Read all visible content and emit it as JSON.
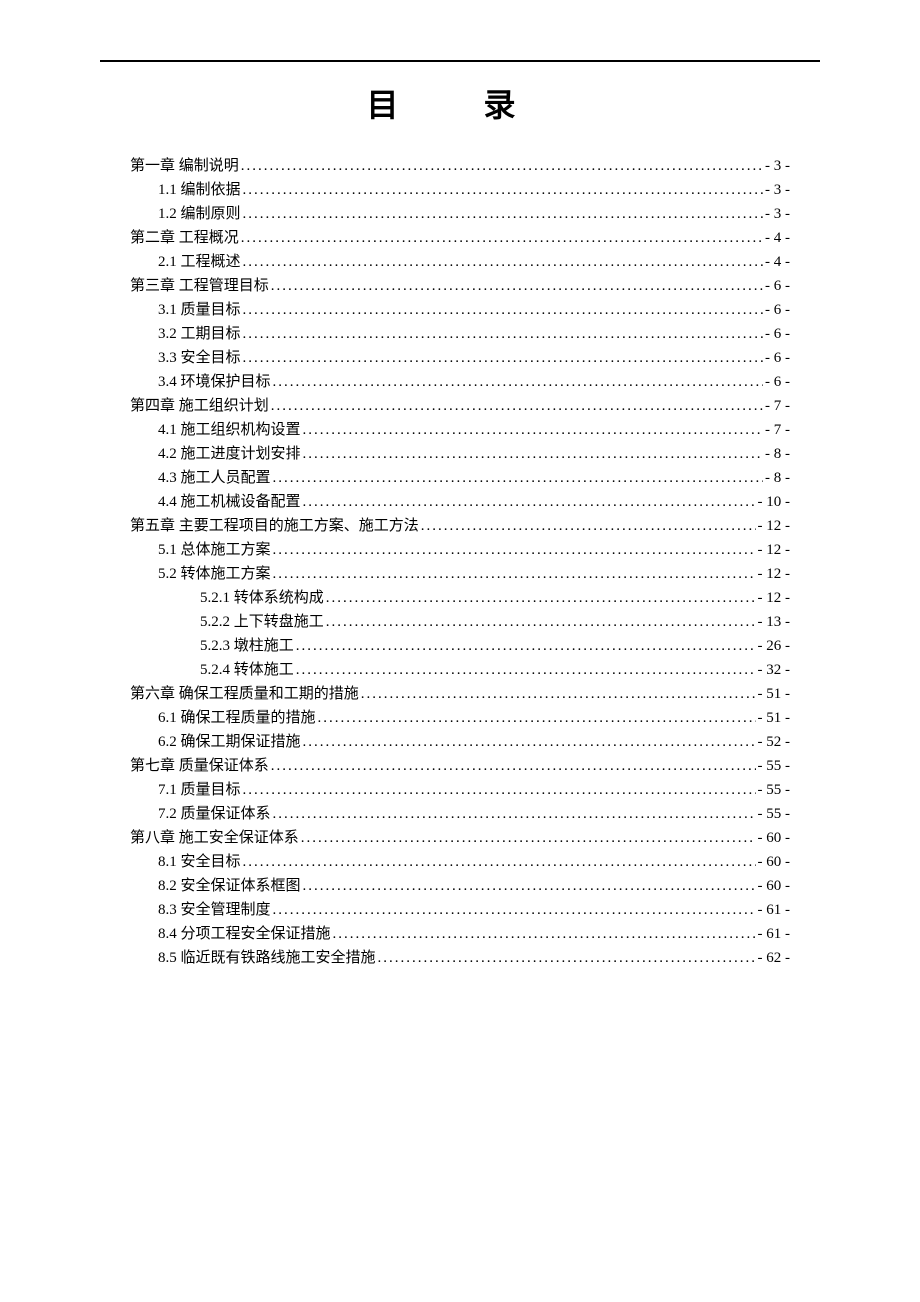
{
  "title": "目 录",
  "toc": [
    {
      "level": 1,
      "label": "第一章  编制说明",
      "page": "- 3 -"
    },
    {
      "level": 2,
      "label": "1.1 编制依据",
      "page": "- 3 -"
    },
    {
      "level": 2,
      "label": "1.2 编制原则",
      "page": "- 3 -"
    },
    {
      "level": 1,
      "label": "第二章  工程概况",
      "page": "- 4 -"
    },
    {
      "level": 2,
      "label": "2.1 工程概述",
      "page": "- 4 -"
    },
    {
      "level": 1,
      "label": "第三章  工程管理目标",
      "page": "- 6 -"
    },
    {
      "level": 2,
      "label": "3.1 质量目标",
      "page": "- 6 -"
    },
    {
      "level": 2,
      "label": "3.2 工期目标",
      "page": "- 6 -"
    },
    {
      "level": 2,
      "label": "3.3 安全目标",
      "page": "- 6 -"
    },
    {
      "level": 2,
      "label": "3.4 环境保护目标",
      "page": "- 6 -"
    },
    {
      "level": 1,
      "label": "第四章  施工组织计划",
      "page": "- 7 -"
    },
    {
      "level": 2,
      "label": "4.1 施工组织机构设置",
      "page": "- 7 -"
    },
    {
      "level": 2,
      "label": "4.2 施工进度计划安排",
      "page": "- 8 -"
    },
    {
      "level": 2,
      "label": "4.3 施工人员配置",
      "page": "- 8 -"
    },
    {
      "level": 2,
      "label": "4.4 施工机械设备配置",
      "page": "- 10 -"
    },
    {
      "level": 1,
      "label": "第五章  主要工程项目的施工方案、施工方法",
      "page": "- 12 -"
    },
    {
      "level": 2,
      "label": "5.1 总体施工方案",
      "page": "- 12 -"
    },
    {
      "level": 2,
      "label": "5.2 转体施工方案",
      "page": "- 12 -"
    },
    {
      "level": 3,
      "label": "5.2.1 转体系统构成",
      "page": "- 12 -"
    },
    {
      "level": 3,
      "label": "5.2.2 上下转盘施工",
      "page": "- 13 -"
    },
    {
      "level": 3,
      "label": "5.2.3 墩柱施工",
      "page": "- 26 -"
    },
    {
      "level": 3,
      "label": "5.2.4 转体施工",
      "page": "- 32 -"
    },
    {
      "level": 1,
      "label": "第六章  确保工程质量和工期的措施",
      "page": "- 51 -"
    },
    {
      "level": 2,
      "label": "6.1 确保工程质量的措施",
      "page": "- 51 -"
    },
    {
      "level": 2,
      "label": "6.2 确保工期保证措施",
      "page": "- 52 -"
    },
    {
      "level": 1,
      "label": "第七章  质量保证体系",
      "page": "- 55 -"
    },
    {
      "level": 2,
      "label": "7.1 质量目标",
      "page": "- 55 -"
    },
    {
      "level": 2,
      "label": "7.2 质量保证体系",
      "page": "- 55 -"
    },
    {
      "level": 1,
      "label": "第八章  施工安全保证体系",
      "page": "- 60 -"
    },
    {
      "level": 2,
      "label": "8.1 安全目标",
      "page": "- 60 -"
    },
    {
      "level": 2,
      "label": "8.2 安全保证体系框图",
      "page": "- 60 -"
    },
    {
      "level": 2,
      "label": "8.3 安全管理制度",
      "page": "- 61 -"
    },
    {
      "level": 2,
      "label": "8.4 分项工程安全保证措施",
      "page": "- 61 -"
    },
    {
      "level": 2,
      "label": "8.5 临近既有铁路线施工安全措施",
      "page": "- 62 -"
    }
  ]
}
